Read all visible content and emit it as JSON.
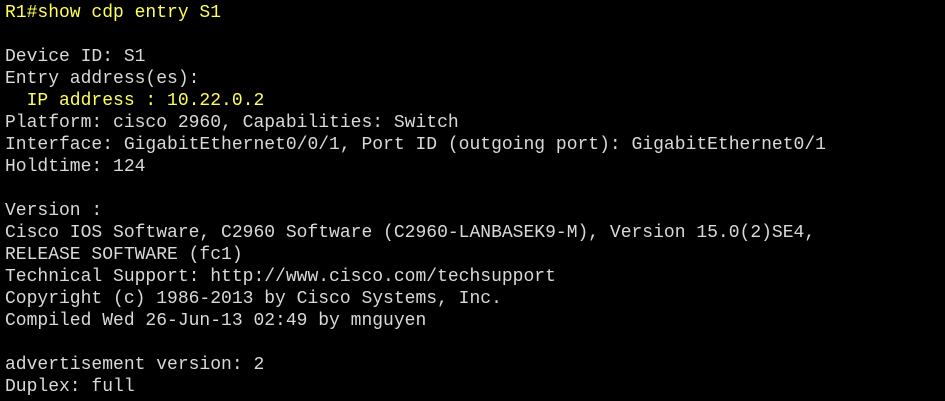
{
  "colors": {
    "background": "#000000",
    "text": "#d9d9d9",
    "highlight": "#ffff55"
  },
  "terminal": {
    "lines": [
      {
        "text": "R1#show cdp entry S1",
        "highlight": true
      },
      {
        "text": "",
        "highlight": false
      },
      {
        "text": "Device ID: S1",
        "highlight": false
      },
      {
        "text": "Entry address(es):",
        "highlight": false
      },
      {
        "text": "  IP address : 10.22.0.2",
        "highlight": true
      },
      {
        "text": "Platform: cisco 2960, Capabilities: Switch",
        "highlight": false
      },
      {
        "text": "Interface: GigabitEthernet0/0/1, Port ID (outgoing port): GigabitEthernet0/1",
        "highlight": false
      },
      {
        "text": "Holdtime: 124",
        "highlight": false
      },
      {
        "text": "",
        "highlight": false
      },
      {
        "text": "Version :",
        "highlight": false
      },
      {
        "text": "Cisco IOS Software, C2960 Software (C2960-LANBASEK9-M), Version 15.0(2)SE4,",
        "highlight": false
      },
      {
        "text": "RELEASE SOFTWARE (fc1)",
        "highlight": false
      },
      {
        "text": "Technical Support: http://www.cisco.com/techsupport",
        "highlight": false
      },
      {
        "text": "Copyright (c) 1986-2013 by Cisco Systems, Inc.",
        "highlight": false
      },
      {
        "text": "Compiled Wed 26-Jun-13 02:49 by mnguyen",
        "highlight": false
      },
      {
        "text": "",
        "highlight": false
      },
      {
        "text": "advertisement version: 2",
        "highlight": false
      },
      {
        "text": "Duplex: full",
        "highlight": false
      }
    ]
  }
}
